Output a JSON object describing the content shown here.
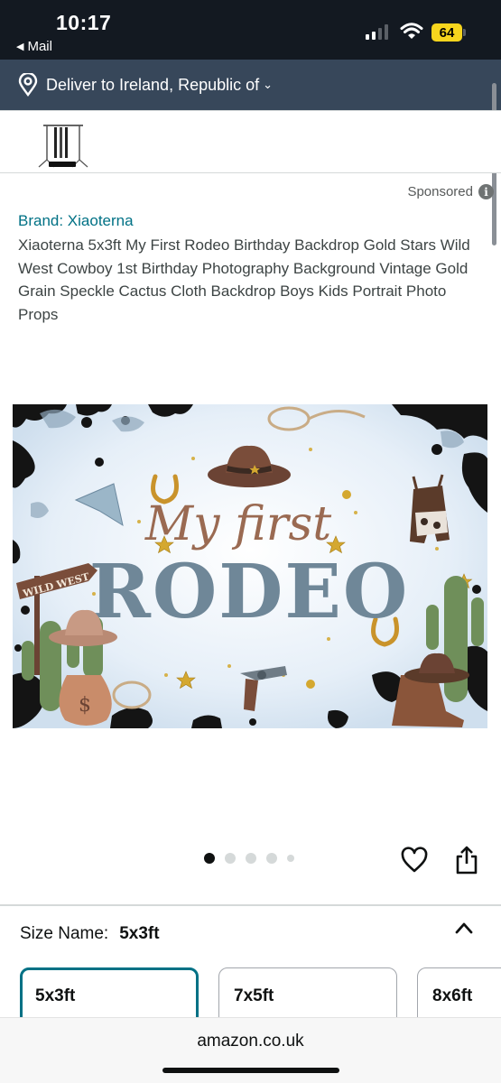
{
  "status_bar": {
    "time": "10:17",
    "back_app": "Mail",
    "back_icon": "back-triangle-icon",
    "battery": "64",
    "battery_color": "#f7d51d"
  },
  "header": {
    "deliver_text": "Deliver to Ireland, Republic of",
    "location_icon": "location-pin-icon",
    "chevron": "⌄",
    "background": "#37475a"
  },
  "ad": {
    "sponsored_label": "Sponsored",
    "info_glyph": "i"
  },
  "product": {
    "brand": "Brand: Xiaoterna",
    "title": "Xiaoterna 5x3ft My First Rodeo Birthday Backdrop Gold Stars Wild West Cowboy 1st Birthday Photography Background Vintage Gold Grain Speckle Cactus Cloth Backdrop Boys Kids Portrait Photo Props",
    "image": {
      "line1": "My first",
      "line2": "RODEO",
      "sign_text": "WILD WEST"
    },
    "carousel": {
      "count": 5,
      "active_index": 0
    }
  },
  "size": {
    "label": "Size Name:",
    "selected": "5x3ft",
    "options": [
      "5x3ft",
      "7x5ft",
      "8x6ft"
    ]
  },
  "browser": {
    "url": "amazon.co.uk"
  },
  "colors": {
    "link": "#007185",
    "status_bg": "#131921",
    "selected_border": "#007185"
  }
}
